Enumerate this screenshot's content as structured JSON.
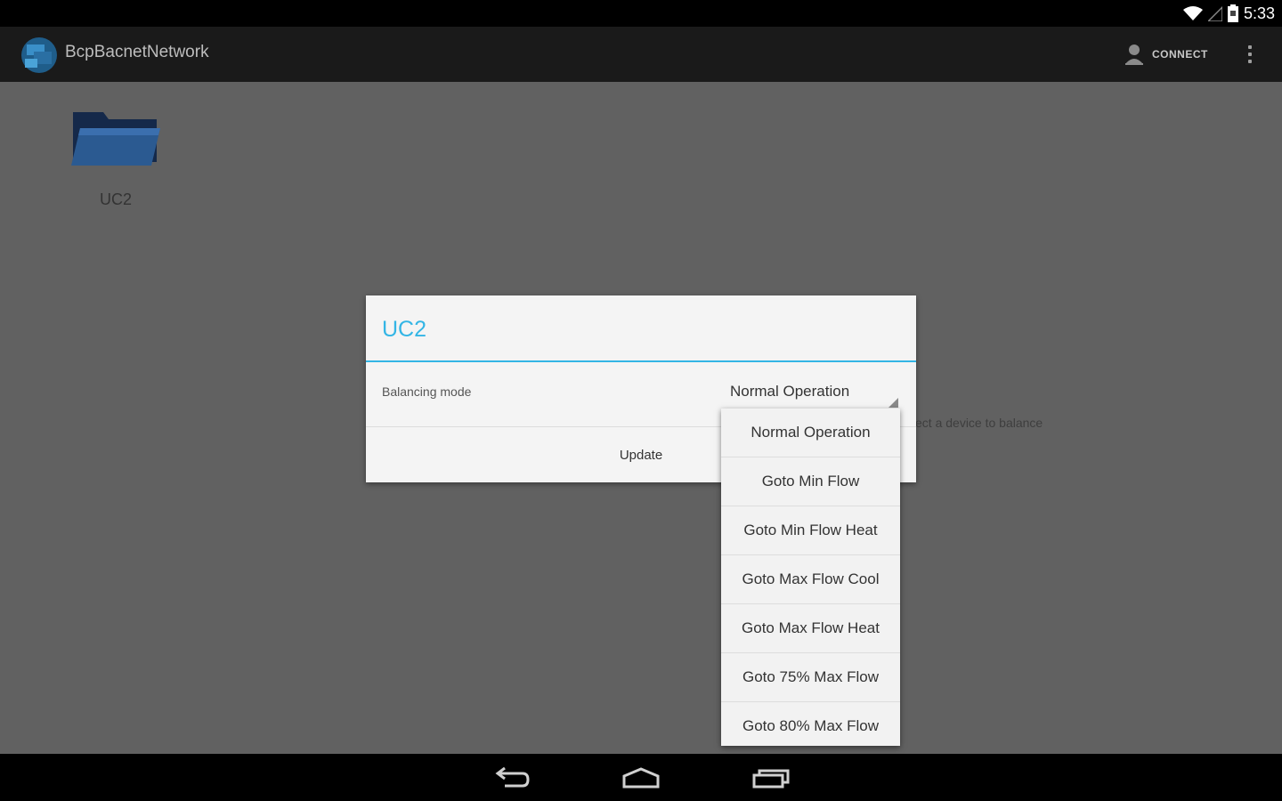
{
  "status_bar": {
    "time": "5:33",
    "icons": [
      "wifi-icon",
      "signal-icon",
      "battery-icon"
    ]
  },
  "action_bar": {
    "app_title": "BcpBacnetNetwork",
    "connect_label": "CONNECT",
    "icons": [
      "app-logo-icon",
      "person-icon",
      "overflow-menu-icon"
    ]
  },
  "content": {
    "device_label": "UC2",
    "hint_text": "ect a device to balance"
  },
  "dialog": {
    "title": "UC2",
    "field_label": "Balancing mode",
    "selected_value": "Normal Operation",
    "update_label": "Update"
  },
  "dropdown": {
    "options": [
      "Normal Operation",
      "Goto Min Flow",
      "Goto Min Flow Heat",
      "Goto Max Flow Cool",
      "Goto Max Flow Heat",
      "Goto 75% Max Flow",
      "Goto 80% Max Flow"
    ]
  },
  "nav_bar": {
    "icons": [
      "back-icon",
      "home-icon",
      "recents-icon"
    ]
  },
  "colors": {
    "accent": "#33b5e5",
    "action_bar": "#1a1a1a",
    "content_background": "#616161",
    "dialog_background": "#f4f4f4"
  }
}
